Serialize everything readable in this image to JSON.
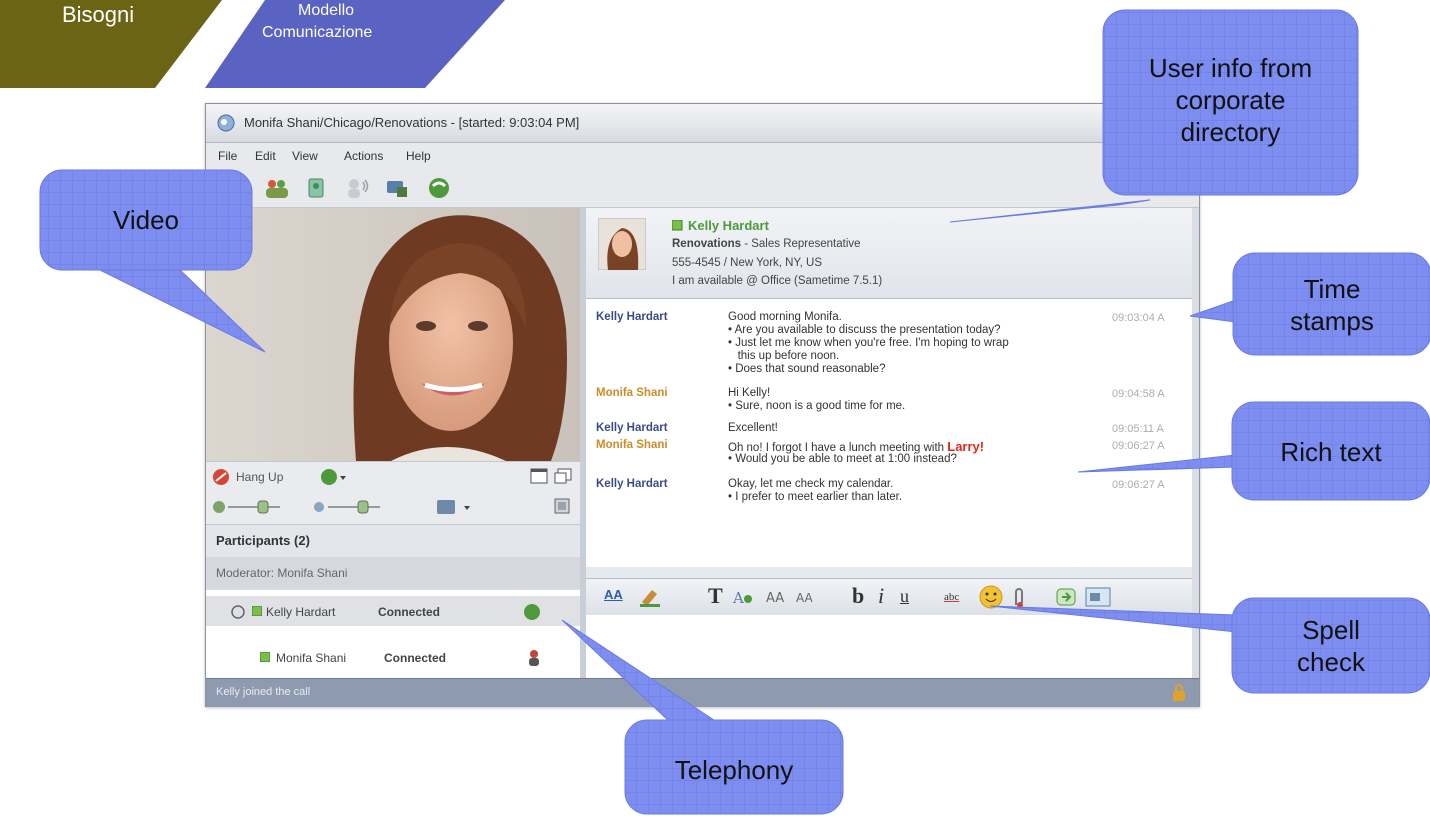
{
  "breadcrumb": {
    "step1": "Bisogni",
    "step2_line1": "Modello",
    "step2_line2": "Comunicazione",
    "colors": {
      "step1": "#6b6414",
      "step2": "#5b63c2"
    }
  },
  "window": {
    "title": "Monifa Shani/Chicago/Renovations - [started: 9:03:04 PM]",
    "menu": [
      "File",
      "Edit",
      "View",
      "Actions",
      "Help"
    ],
    "toolbar_icons": [
      "add-person-icon",
      "group-icon",
      "invite-icon",
      "audio-icon",
      "video-call-icon",
      "phone-icon"
    ]
  },
  "video": {
    "hang_up": "Hang Up",
    "phone_dropdown_icon": "phone-icon"
  },
  "participants": {
    "header": "Participants (2)",
    "moderator": "Moderator: Monifa Shani",
    "rows": [
      {
        "name": "Kelly Hardart",
        "status": "Connected"
      },
      {
        "name": "Monifa Shani",
        "status": "Connected"
      }
    ]
  },
  "status_bar": "Kelly joined the call",
  "user_info": {
    "name": "Kelly Hardart",
    "org_line_bold": "Renovations",
    "org_line_rest": " - Sales Representative",
    "phone_location": "555-4545 / New York, NY, US",
    "availability": "I am available @ Office (Sametime 7.5.1)"
  },
  "transcript": [
    {
      "sender": "Kelly Hardart",
      "color": "#3a4c88",
      "stamp": "09:03:04 A",
      "lines": [
        "Good morning Monifa.",
        "• Are you available to discuss the presentation today?",
        "• Just let me know when you're free. I'm hoping to wrap",
        "   this up before noon.",
        "• Does that sound reasonable?"
      ]
    },
    {
      "sender": "Monifa Shani",
      "color": "#d08a2c",
      "stamp": "09:04:58 A",
      "lines": [
        "Hi Kelly!",
        "• Sure, noon is a good time for me."
      ]
    },
    {
      "sender": "Kelly Hardart",
      "color": "#3a4c88",
      "stamp": "09:05:11 A",
      "lines": [
        "Excellent!"
      ]
    },
    {
      "sender": "Monifa Shani",
      "color": "#d08a2c",
      "stamp": "09:06:27 A",
      "lines": [
        "Oh no! I forgot I have a lunch meeting with ",
        "• Would you be able to meet at 1:00 instead?"
      ],
      "rich": "Larry!"
    },
    {
      "sender": "Kelly Hardart",
      "color": "#3a4c88",
      "stamp": "09:06:27 A",
      "lines": [
        "Okay, let me check my calendar.",
        "• I prefer to meet earlier than later."
      ]
    }
  ],
  "format_bar": {
    "items": [
      "AA",
      "T",
      "b",
      "i",
      "u",
      "abc"
    ]
  },
  "callouts": {
    "user_info": [
      "User info from",
      "corporate",
      "directory"
    ],
    "video": "Video",
    "time_stamps": [
      "Time",
      "stamps"
    ],
    "rich_text": "Rich text",
    "spell_check": [
      "Spell",
      "check"
    ],
    "telephony": "Telephony"
  }
}
